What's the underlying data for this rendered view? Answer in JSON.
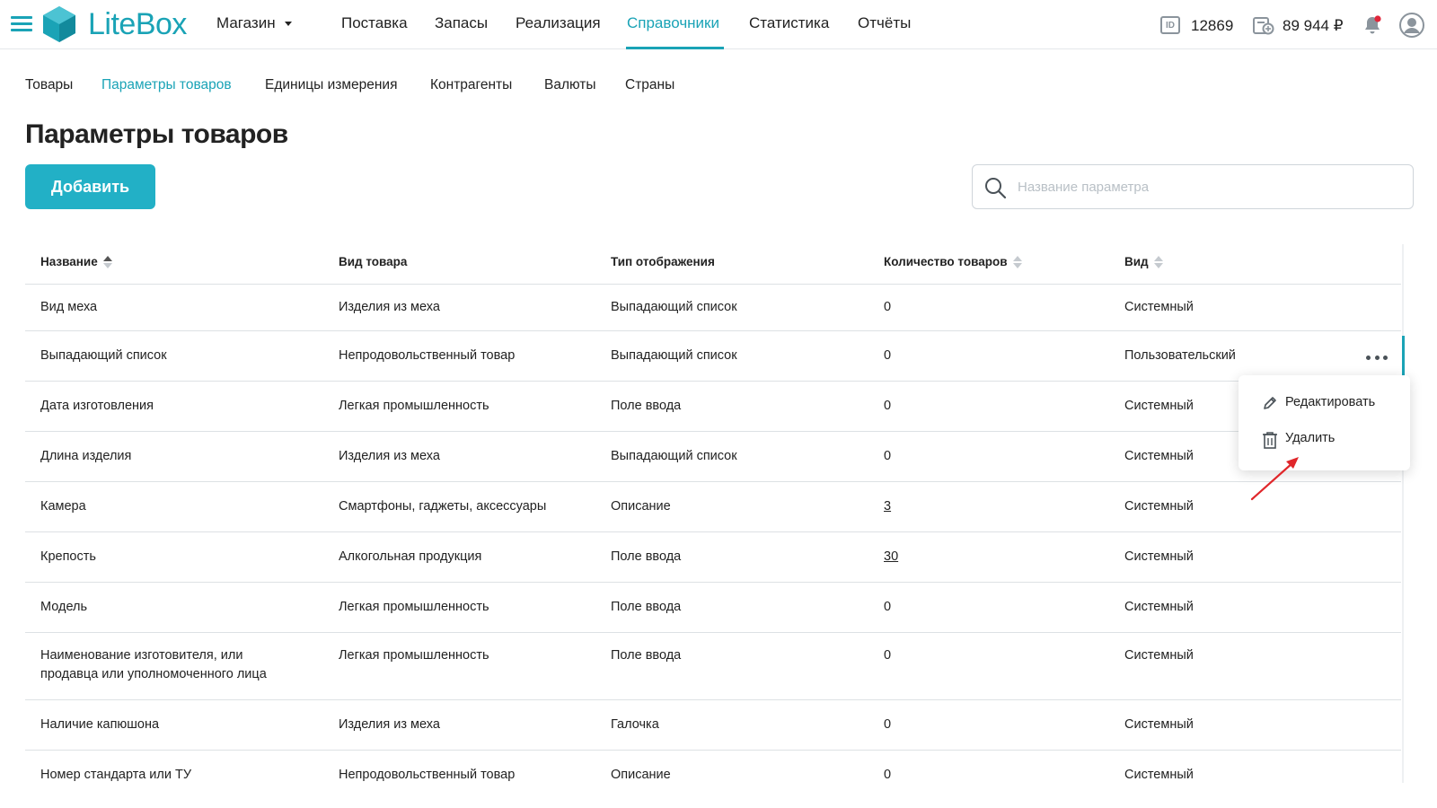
{
  "header": {
    "logo_text": "LiteBox",
    "store_label": "Магазин",
    "nav": [
      "Поставка",
      "Запасы",
      "Реализация",
      "Справочники",
      "Статистика",
      "Отчёты"
    ],
    "active_nav": "Справочники",
    "id_icon_text": "ID",
    "id_value": "12869",
    "balance": "89 944 ₽",
    "icons": [
      "menu-icon",
      "logo-icon",
      "chevron-down-icon",
      "id-icon",
      "wallet-icon",
      "bell-icon",
      "user-icon"
    ],
    "accent_color": "#1aa3b6",
    "notification_dot_color": "#e0263a"
  },
  "subnav": {
    "items": [
      "Товары",
      "Параметры товаров",
      "Единицы измерения",
      "Контрагенты",
      "Валюты",
      "Страны"
    ],
    "active": "Параметры товаров"
  },
  "page": {
    "title": "Параметры товаров",
    "add_button": "Добавить",
    "search_placeholder": "Название параметра",
    "button_color": "#22b0c6"
  },
  "table": {
    "columns": [
      "Название",
      "Вид товара",
      "Тип отображения",
      "Количество товаров",
      "Вид"
    ],
    "sort": {
      "column": "Название",
      "direction": "asc"
    },
    "rows": [
      {
        "name": "Вид меха",
        "product_type": "Изделия из меха",
        "display_type": "Выпадающий список",
        "count": "0",
        "kind": "Системный"
      },
      {
        "name": "Выпадающий список",
        "product_type": "Непродовольственный товар",
        "display_type": "Выпадающий список",
        "count": "0",
        "kind": "Пользовательский"
      },
      {
        "name": "Дата изготовления",
        "product_type": "Легкая промышленность",
        "display_type": "Поле ввода",
        "count": "0",
        "kind": "Системный"
      },
      {
        "name": "Длина изделия",
        "product_type": "Изделия из меха",
        "display_type": "Выпадающий список",
        "count": "0",
        "kind": "Системный"
      },
      {
        "name": "Камера",
        "product_type": "Смартфоны, гаджеты, аксессуары",
        "display_type": "Описание",
        "count": "3",
        "kind": "Системный"
      },
      {
        "name": "Крепость",
        "product_type": "Алкогольная продукция",
        "display_type": "Поле ввода",
        "count": "30",
        "kind": "Системный"
      },
      {
        "name": "Модель",
        "product_type": "Легкая промышленность",
        "display_type": "Поле ввода",
        "count": "0",
        "kind": "Системный"
      },
      {
        "name": "Наименование изготовителя, или продавца или уполномоченного лица",
        "product_type": "Легкая промышленность",
        "display_type": "Поле ввода",
        "count": "0",
        "kind": "Системный"
      },
      {
        "name": "Наличие капюшона",
        "product_type": "Изделия из меха",
        "display_type": "Галочка",
        "count": "0",
        "kind": "Системный"
      },
      {
        "name": "Номер стандарта или ТУ",
        "product_type": "Непродовольственный товар",
        "display_type": "Описание",
        "count": "0",
        "kind": "Системный"
      }
    ]
  },
  "context_menu": {
    "items": [
      {
        "label": "Редактировать",
        "icon": "pencil-icon"
      },
      {
        "label": "Удалить",
        "icon": "trash-icon"
      }
    ]
  },
  "annotation": {
    "arrow_color": "#e0262a"
  }
}
